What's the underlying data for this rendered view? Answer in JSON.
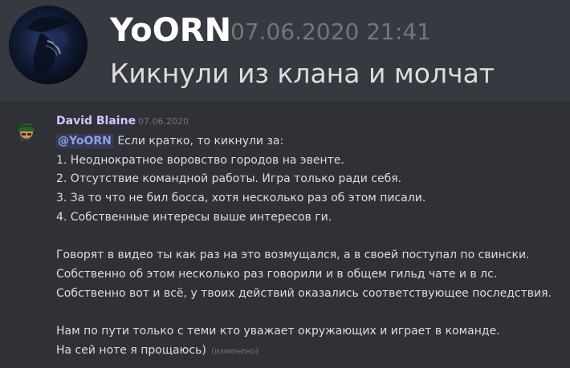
{
  "top_message": {
    "username": "YoORN",
    "timestamp": "07.06.2020 21:41",
    "text": "Кикнули из клана и молчат"
  },
  "reply_message": {
    "username": "David Blaine",
    "timestamp": "07.06.2020",
    "mention": "@YoORN",
    "lines": {
      "l1_after_mention": "Если кратко, то кикнули за:",
      "l2": "1. Неоднократное воровство городов на эвенте.",
      "l3": "2. Отсутствие командной работы. Игра только ради себя.",
      "l4": "3. За то что не бил босса, хотя несколько раз об этом писали.",
      "l5": "4. Собственные интересы выше интересов ги.",
      "l6": "Говорят в видео ты как раз на это возмущался, а в своей поступал по свински.",
      "l7": "Собственно об этом несколько раз говорили и в общем гильд чате и в лс.",
      "l8": "Собственно вот и всё, у твоих действий оказались соответствующее последствия.",
      "l9": "Нам по пути только с теми кто уважает окружающих и играет в команде.",
      "l10": "На сей ноте я прощаюсь)"
    },
    "edited_label": "(изменено)"
  },
  "colors": {
    "bg_top": "#36393f",
    "bg_reply": "#2f3136",
    "username_reply": "#d4c4ff",
    "timestamp": "#72767d",
    "mention_text": "#8ea1e1"
  }
}
